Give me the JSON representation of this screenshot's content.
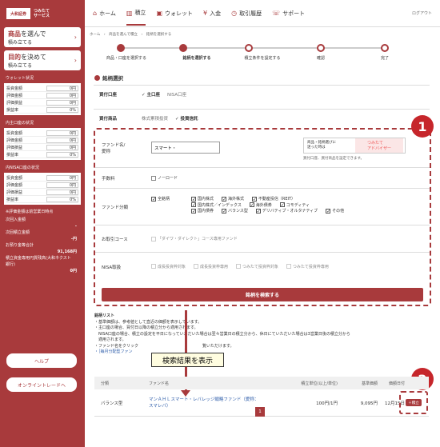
{
  "brand": {
    "name1": "大和証券",
    "name2": "つみたて\nサービス"
  },
  "sidebar": {
    "btn1": {
      "l1_accent": "商品",
      "l1_rest": "を選んで",
      "l2": "積み立てる",
      "arrow": "›"
    },
    "btn2": {
      "l1_accent": "目的",
      "l1_rest": "を決めて",
      "l2": "積み立てる",
      "arrow": "›"
    },
    "sections": [
      {
        "title": "ウォレット状況",
        "rows": [
          {
            "label": "投資金額",
            "value": "0円"
          },
          {
            "label": "評価金額",
            "value": "0円"
          },
          {
            "label": "評価損益",
            "value": "0円"
          },
          {
            "label": "損益率",
            "value": "0%"
          }
        ]
      },
      {
        "title": "内主口座の状況",
        "rows": [
          {
            "label": "投資金額",
            "value": "0円"
          },
          {
            "label": "評価金額",
            "value": "0円"
          },
          {
            "label": "評価損益",
            "value": "0円"
          },
          {
            "label": "損益率",
            "value": "0%"
          }
        ]
      },
      {
        "title": "内NISA口座の状況",
        "rows": [
          {
            "label": "投資金額",
            "value": "0円"
          },
          {
            "label": "評価金額",
            "value": "0円"
          },
          {
            "label": "評価損益",
            "value": "0円"
          },
          {
            "label": "損益率",
            "value": "0%"
          }
        ]
      }
    ],
    "note": "※評価金額は前営業日時点",
    "totals": [
      {
        "label": "次回入金額",
        "value": "-"
      },
      {
        "label": "次回積立金額",
        "value": "-円"
      },
      {
        "label": "お預り金等合計",
        "value": "91,168円"
      },
      {
        "label": "積立資金専用円貨残高(大和ネクスト銀行)",
        "value": "0円"
      }
    ],
    "help": "ヘルプ",
    "online_trade": "オンライントレードへ"
  },
  "nav": {
    "items": [
      {
        "icon": "⌂",
        "label": "ホーム"
      },
      {
        "icon": "▥",
        "label": "積立"
      },
      {
        "icon": "▣",
        "label": "ウォレット"
      },
      {
        "icon": "¥",
        "label": "入金"
      },
      {
        "icon": "◷",
        "label": "取引履歴"
      },
      {
        "icon": "☏",
        "label": "サポート"
      }
    ],
    "logout": "ログアウト"
  },
  "breadcrumb": "ホーム　›　商品を選んで積立　›　銘柄を選択する",
  "steps": [
    "商品・口座を選択する",
    "銘柄を選択する",
    "積立条件を設定する",
    "確認",
    "完了"
  ],
  "section_title": "銘柄選択",
  "account": {
    "label": "買付口座",
    "opt1": "主口座",
    "opt2": "NISA口座"
  },
  "product": {
    "label": "買付商品",
    "opt1": "株式累積投資",
    "opt2": "投資信託"
  },
  "form": {
    "fund_name_label": "ファンド名/\n愛称",
    "fund_name_value": "スマート・",
    "ad_text": "商品・銘柄選びに\n迷った時は",
    "ad_brand": "つみたて\nアドバイザー",
    "ad_note": "買付口座、買付商品を設定できます。",
    "fee_label": "手数料",
    "fee_opt": "ノーロード",
    "class_label": "ファンド分類",
    "class_all": "全銘柄",
    "class_opts": [
      "国内株式",
      "海外株式",
      "不動産投信（REIT）",
      "国内株式／インデックス",
      "海外債券",
      "コモディティ",
      "国内債券",
      "バランス型",
      "デリバティブ・オルタナティブ",
      "その他"
    ],
    "course_label": "お取引コース",
    "course_opt": "「ダイワ・ダイレクト」コース専用ファンド",
    "nisa_label": "NISA取扱",
    "nisa_opts": [
      "成長投資枠対象",
      "成長投資枠専用",
      "つみたて投資枠対象",
      "つみたて投資枠専用"
    ],
    "search_btn": "銘柄を検索する"
  },
  "notes": {
    "header": "銘柄リスト",
    "lines": [
      "・基準価額は、参考値として直近の価額を表示しています。",
      "・主口座の場合、買付日以降の積立分から適用されます。",
      "　NISA口座の場合、積立の設定を平日になっていただいた場合は翌々営業日の積立分から、休日にていただいた場合は3営業日後の積立分から",
      "　適用されます。",
      "・ファンド名をクリック　　　　　　　　　　　　　　　　覧いただけます。",
      "・［毎月分配型ファン　　　　　　　　　　　　　］"
    ]
  },
  "callout": "検索結果を表示",
  "badges": [
    "1",
    "2"
  ],
  "table": {
    "headers": [
      "分類",
      "ファンド名",
      "積立単位(以上/単位)",
      "基準価額",
      "価額日付"
    ],
    "row": {
      "category": "バランス型",
      "fund": "マンＡＨＬスマート・レバレッジ戦略ファンド（愛称：スマレバ）",
      "unit": "100円/1円",
      "price": "9,095円",
      "date": "12月15日",
      "btn": "＋積立"
    }
  },
  "page": "1"
}
